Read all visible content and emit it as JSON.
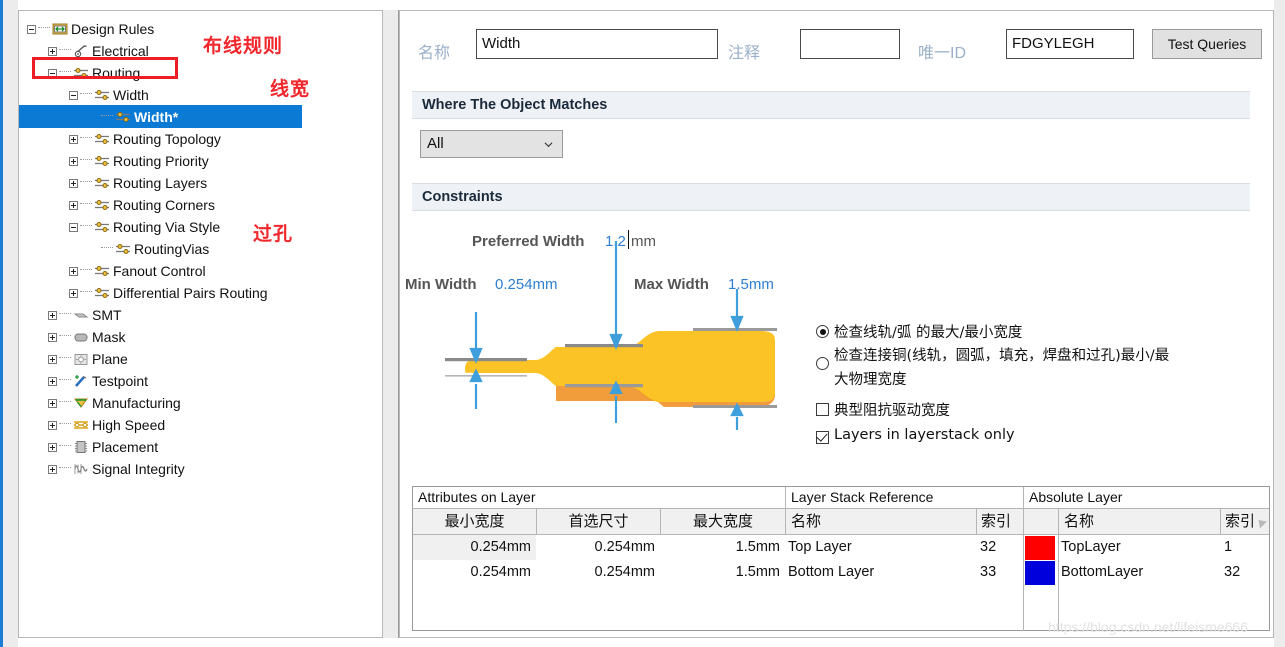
{
  "tree": {
    "nodes": [
      {
        "label": "Design Rules",
        "depth": 0,
        "toggle": "minus",
        "icon": "design-rules-icon",
        "selected": false
      },
      {
        "label": "Electrical",
        "depth": 1,
        "toggle": "plus",
        "icon": "electrical-icon",
        "selected": false
      },
      {
        "label": "Routing",
        "depth": 1,
        "toggle": "minus",
        "icon": "routing-icon",
        "selected": false
      },
      {
        "label": "Width",
        "depth": 2,
        "toggle": "minus",
        "icon": "routing-icon",
        "selected": false
      },
      {
        "label": "Width*",
        "depth": 3,
        "toggle": "none",
        "icon": "routing-icon",
        "selected": true
      },
      {
        "label": "Routing Topology",
        "depth": 2,
        "toggle": "plus",
        "icon": "routing-icon",
        "selected": false
      },
      {
        "label": "Routing Priority",
        "depth": 2,
        "toggle": "plus",
        "icon": "routing-icon",
        "selected": false
      },
      {
        "label": "Routing Layers",
        "depth": 2,
        "toggle": "plus",
        "icon": "routing-icon",
        "selected": false
      },
      {
        "label": "Routing Corners",
        "depth": 2,
        "toggle": "plus",
        "icon": "routing-icon",
        "selected": false
      },
      {
        "label": "Routing Via Style",
        "depth": 2,
        "toggle": "minus",
        "icon": "routing-icon",
        "selected": false
      },
      {
        "label": "RoutingVias",
        "depth": 3,
        "toggle": "none",
        "icon": "routing-icon",
        "selected": false
      },
      {
        "label": "Fanout Control",
        "depth": 2,
        "toggle": "plus",
        "icon": "routing-icon",
        "selected": false
      },
      {
        "label": "Differential Pairs Routing",
        "depth": 2,
        "toggle": "plus",
        "icon": "routing-icon",
        "selected": false
      },
      {
        "label": "SMT",
        "depth": 1,
        "toggle": "plus",
        "icon": "smt-icon",
        "selected": false
      },
      {
        "label": "Mask",
        "depth": 1,
        "toggle": "plus",
        "icon": "mask-icon",
        "selected": false
      },
      {
        "label": "Plane",
        "depth": 1,
        "toggle": "plus",
        "icon": "plane-icon",
        "selected": false
      },
      {
        "label": "Testpoint",
        "depth": 1,
        "toggle": "plus",
        "icon": "testpoint-icon",
        "selected": false
      },
      {
        "label": "Manufacturing",
        "depth": 1,
        "toggle": "plus",
        "icon": "manufacturing-icon",
        "selected": false
      },
      {
        "label": "High Speed",
        "depth": 1,
        "toggle": "plus",
        "icon": "high-speed-icon",
        "selected": false
      },
      {
        "label": "Placement",
        "depth": 1,
        "toggle": "plus",
        "icon": "placement-icon",
        "selected": false
      },
      {
        "label": "Signal Integrity",
        "depth": 1,
        "toggle": "plus",
        "icon": "signal-integrity-icon",
        "selected": false
      }
    ]
  },
  "annotations": {
    "routing_rules": "布线规则",
    "line_width": "线宽",
    "via": "过孔"
  },
  "header": {
    "name_label": "名称",
    "name_value": "Width",
    "comment_label": "注释",
    "comment_value": "",
    "unique_id_label": "唯一ID",
    "unique_id_value": "FDGYLEGH",
    "test_queries_button": "Test Queries"
  },
  "where_section": {
    "title": "Where The Object Matches",
    "scope_selected": "All"
  },
  "constraints_section": {
    "title": "Constraints",
    "preferred_width_label": "Preferred Width",
    "preferred_width_value": "1.2",
    "preferred_width_unit": "mm",
    "min_width_label": "Min Width",
    "min_width_value": "0.254mm",
    "max_width_label": "Max Width",
    "max_width_value": "1.5mm",
    "options": {
      "radio1": "检查线轨/弧 的最大/最小宽度",
      "radio2_line1": "检查连接铜(线轨，圆弧，填充，焊盘和过孔)最小/最",
      "radio2_line2": "大物理宽度",
      "check1": "典型阻抗驱动宽度",
      "check2": "Layers in layerstack only",
      "radio1_selected": true,
      "radio2_selected": false,
      "check1_checked": false,
      "check2_checked": true
    }
  },
  "table": {
    "group_headers": [
      "Attributes on Layer",
      "Layer Stack Reference",
      "Absolute Layer"
    ],
    "columns": [
      "最小宽度",
      "首选尺寸",
      "最大宽度",
      "名称",
      "索引",
      "",
      "名称",
      "索引"
    ],
    "rows": [
      {
        "min": "0.254mm",
        "preferred": "0.254mm",
        "max": "1.5mm",
        "stack_name": "Top Layer",
        "stack_index": "32",
        "color": "#ff0000",
        "abs_name": "TopLayer",
        "abs_index": "1",
        "highlighted": true
      },
      {
        "min": "0.254mm",
        "preferred": "0.254mm",
        "max": "1.5mm",
        "stack_name": "Bottom Layer",
        "stack_index": "33",
        "color": "#0000dd",
        "abs_name": "BottomLayer",
        "abs_index": "32",
        "highlighted": false
      }
    ]
  },
  "watermark": "https://blog.csdn.net/lifeisme666"
}
